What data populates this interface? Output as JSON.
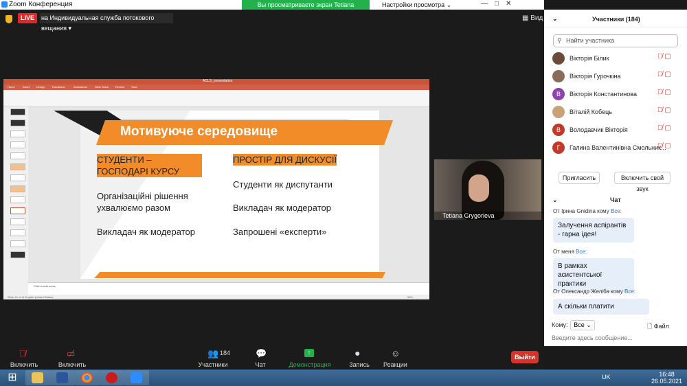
{
  "window": {
    "title": "Zoom Конференция",
    "minimize": "—",
    "maximize": "□",
    "close": "✕"
  },
  "share_banner": "Вы просматриваете экран Tetiana Grygorieva",
  "view_options": "Настройки просмотра ⌄",
  "live": {
    "badge": "LIVE",
    "destination": "на Индивидуальная служба потокового вещания ▾"
  },
  "view_button": "Вид",
  "ppt": {
    "file_title": "ACLS_presentation",
    "tabs": [
      "Home",
      "Insert",
      "Design",
      "Transitions",
      "Animations",
      "Slide Show",
      "Review",
      "View"
    ],
    "notes_placeholder": "Click to add notes",
    "status": "Slide 10 of 14   English (United States)",
    "zoom": "96%"
  },
  "slide": {
    "number": "10",
    "title": "Мотивуюче середовище",
    "left_heading": "СТУДЕНТИ – ГОСПОДАРІ КУРСУ",
    "left_items": [
      "Організаційні рішення ухвалюємо разом",
      "Викладач як модератор"
    ],
    "right_heading": "ПРОСТІР ДЛЯ ДИСКУСІЇ",
    "right_items": [
      "Студенти як диспутанти",
      "Викладач як модератор",
      "Запрошені «експерти»"
    ]
  },
  "webcam": {
    "name": "Tetiana Grygorieva"
  },
  "participants": {
    "header": "Участники (184)",
    "search_placeholder": "Найти участника",
    "list": [
      {
        "name": "Вікторія Білик",
        "initial": "",
        "color": "#6b4a3a"
      },
      {
        "name": "Вікторія Гурочкіна",
        "initial": "",
        "color": "#8a6a5a"
      },
      {
        "name": "Вікторія Константинова",
        "initial": "В",
        "color": "#8e44ad"
      },
      {
        "name": "Віталій Кобець",
        "initial": "",
        "color": "#c9a27a"
      },
      {
        "name": "Володавчик Вікторія",
        "initial": "В",
        "color": "#c0392b"
      },
      {
        "name": "Галина Валентинівна Смольник...",
        "initial": "Г",
        "color": "#c0392b"
      }
    ],
    "invite": "Пригласить",
    "unmute": "Включить свой звук"
  },
  "chat": {
    "header": "Чат",
    "messages": [
      {
        "from": "От Ірина Gnidina кому ",
        "to": "Все:",
        "text": "Залучення аспірантів - гарна ідея!"
      },
      {
        "from": "От меня ",
        "to": "Все:",
        "text": "В рамках асистентської практики"
      },
      {
        "from": "От Олександр Желіба кому ",
        "to": "Все:",
        "text": "А скільки платити"
      }
    ],
    "to_label": "Кому:",
    "to_value": "Все ⌄",
    "file": "Файл",
    "input_placeholder": "Введите здесь сообщение..."
  },
  "toolbar": {
    "mic": "Включить звук",
    "video": "Включить видео",
    "participants": "Участники",
    "participants_count": "184",
    "chat": "Чат",
    "share": "Демонстрация экрана",
    "record": "Запись",
    "reactions": "Реакции",
    "leave": "Выйти"
  },
  "taskbar": {
    "lang": "UK",
    "time": "16:48",
    "date": "26.05.2021"
  },
  "colors": {
    "accent": "#f28c28",
    "share_green": "#22b14c",
    "leave_red": "#d6332a",
    "zoom_blue": "#2d8cff"
  }
}
